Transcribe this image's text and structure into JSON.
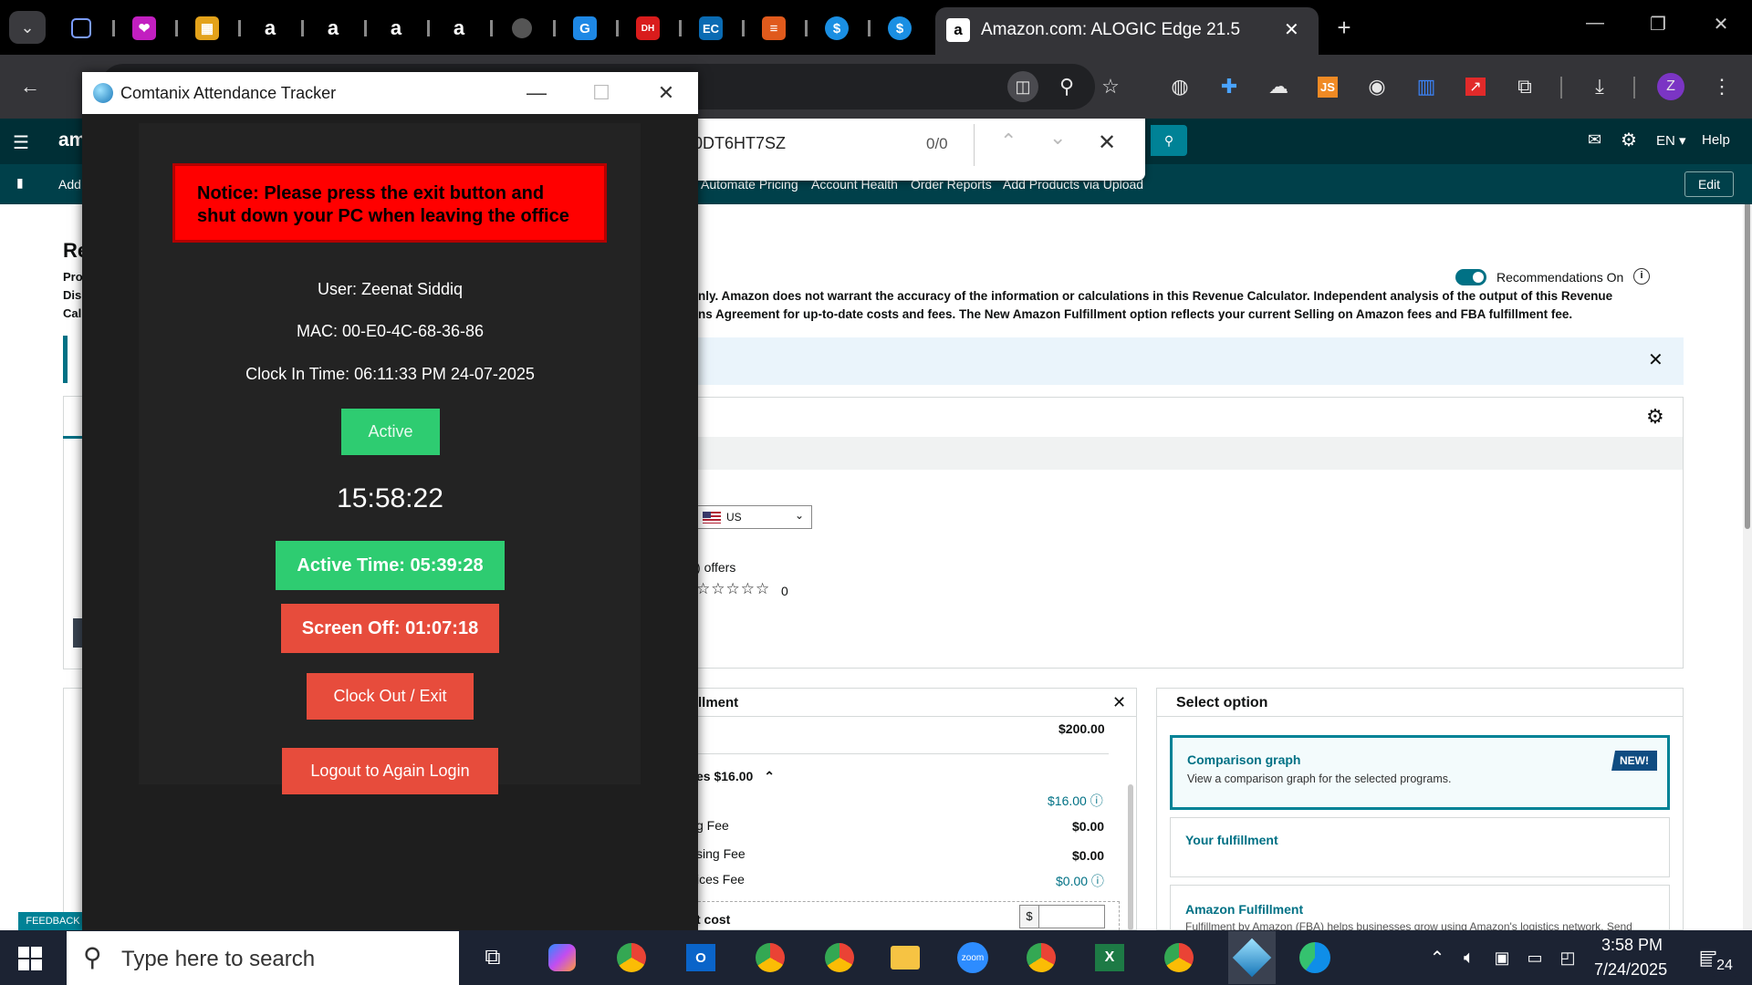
{
  "browser": {
    "active_tab_title": "Amazon.com: ALOGIC Edge 21.5",
    "find": {
      "query": "0DT6HT7SZ",
      "count": "0/0"
    },
    "profile_initial": "Z"
  },
  "seller_nav": {
    "logo": "am",
    "links": [
      "Add",
      "Automate Pricing",
      "Account Health",
      "Order Reports",
      "Add Products via Upload"
    ],
    "right": {
      "lang": "EN ▾",
      "help": "Help",
      "edit": "Edit"
    }
  },
  "page": {
    "heading_fragment": "Re",
    "left_fragments": [
      "Pro",
      "Dis",
      "Cal"
    ],
    "recommendations_label": "Recommendations On",
    "disclaimer_line1": "nly. Amazon does not warrant the accuracy of the information or calculations in this Revenue Calculator. Independent analysis of the output of this Revenue",
    "disclaimer_line2": "ns Agreement for up-to-date costs and fees. The New Amazon Fulfillment option reflects your current Selling on Amazon fees and FBA fulfillment fee.",
    "country": "US",
    "offers_text": "offers",
    "rating_count": "0",
    "feedback": "FEEDBACK"
  },
  "fulfillment_panel": {
    "title": "llment",
    "price": "$200.00",
    "fees_label": "es $16.00",
    "rows": [
      {
        "label": "",
        "value": "$16.00",
        "link": true
      },
      {
        "label": "g Fee",
        "value": "$0.00",
        "link": false
      },
      {
        "label": "sing Fee",
        "value": "$0.00",
        "link": false
      },
      {
        "label": "ices Fee",
        "value": "$0.00",
        "link": true
      }
    ],
    "cost_label": "t cost",
    "currency": "$"
  },
  "select_option": {
    "title": "Select option",
    "comparison_title": "Comparison graph",
    "comparison_desc": "View a comparison graph for the selected programs.",
    "new_badge": "NEW!",
    "your_fulfillment": "Your fulfillment",
    "amazon_fulfillment": "Amazon Fulfillment",
    "amazon_fulfillment_desc": "Fulfillment by Amazon (FBA) helps businesses grow using Amazon's logistics network. Send"
  },
  "tracker": {
    "title": "Comtanix Attendance Tracker",
    "notice": "Notice: Please press the exit button and shut down your PC when leaving the office",
    "user": "User: Zeenat Siddiq",
    "mac": "MAC: 00-E0-4C-68-36-86",
    "clock_in": "Clock In Time: 06:11:33 PM 24-07-2025",
    "status": "Active",
    "clock": "15:58:22",
    "active_time": "Active Time: 05:39:28",
    "screen_off": "Screen Off: 01:07:18",
    "clock_out": "Clock Out / Exit",
    "logout": "Logout to Again Login",
    "colors": {
      "green": "#2ecc71",
      "red": "#e74c3c",
      "notice_red": "#ff0000"
    }
  },
  "taskbar": {
    "search_placeholder": "Type here to search",
    "time": "3:58 PM",
    "date": "7/24/2025",
    "notification_count": "24"
  }
}
